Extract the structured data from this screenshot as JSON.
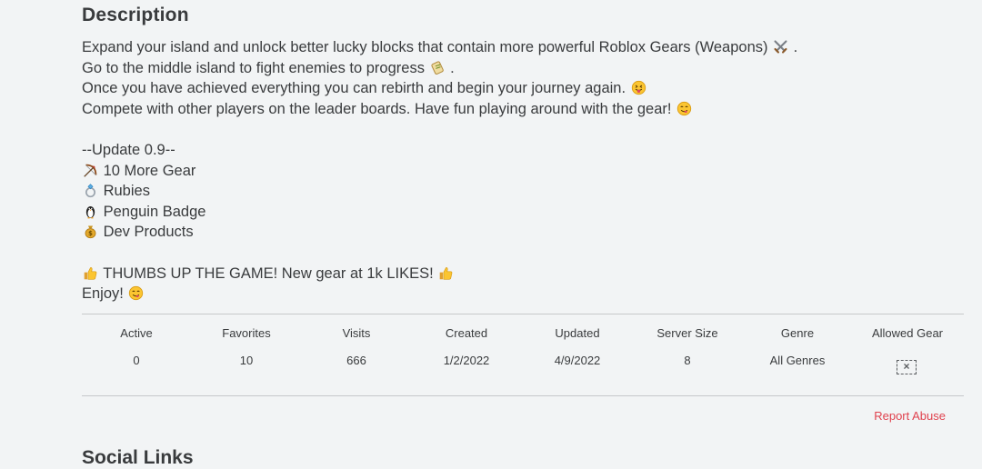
{
  "description": {
    "heading": "Description",
    "lines": [
      {
        "text": "Expand your island and unlock better lucky blocks that contain more powerful Roblox Gears (Weapons) ",
        "emoji": "crossed-swords-icon",
        "suffix": " ."
      },
      {
        "text": "Go to the middle island to fight enemies to progress ",
        "emoji": "scroll-icon",
        "suffix": " ."
      },
      {
        "text": "Once you have achieved everything you can rebirth and begin your journey again. ",
        "emoji": "tongue-face-icon",
        "suffix": ""
      },
      {
        "text": "Compete with other players on the leader boards. Have fun playing around with the gear! ",
        "emoji": "yum-face-icon",
        "suffix": ""
      },
      {
        "text": "",
        "emoji": "",
        "suffix": ""
      },
      {
        "text": "--Update 0.9--",
        "emoji": "",
        "suffix": ""
      },
      {
        "prefix_emoji": "bow-arrow-icon",
        "text": " 10 More Gear"
      },
      {
        "prefix_emoji": "ring-icon",
        "text": " Rubies"
      },
      {
        "prefix_emoji": "penguin-icon",
        "text": " Penguin Badge"
      },
      {
        "prefix_emoji": "money-bag-icon",
        "text": " Dev Products"
      },
      {
        "text": "",
        "emoji": "",
        "suffix": ""
      },
      {
        "prefix_emoji": "thumbs-up-icon",
        "text": " THUMBS UP THE GAME! New gear at 1k LIKES! ",
        "emoji": "thumbs-up-icon",
        "suffix": ""
      },
      {
        "text": "Enjoy! ",
        "emoji": "yum-face-icon",
        "suffix": ""
      }
    ]
  },
  "stats": {
    "columns": [
      {
        "label": "Active",
        "value": "0"
      },
      {
        "label": "Favorites",
        "value": "10"
      },
      {
        "label": "Visits",
        "value": "666"
      },
      {
        "label": "Created",
        "value": "1/2/2022"
      },
      {
        "label": "Updated",
        "value": "4/9/2022"
      },
      {
        "label": "Server Size",
        "value": "8"
      },
      {
        "label": "Genre",
        "value": "All Genres"
      },
      {
        "label": "Allowed Gear",
        "value": ""
      }
    ]
  },
  "report_abuse": "Report Abuse",
  "social_heading": "Social Links",
  "colors": {
    "background": "#f2f4f5",
    "text": "#393b3d",
    "report": "#e0424e",
    "divider": "#c6c8ca"
  }
}
